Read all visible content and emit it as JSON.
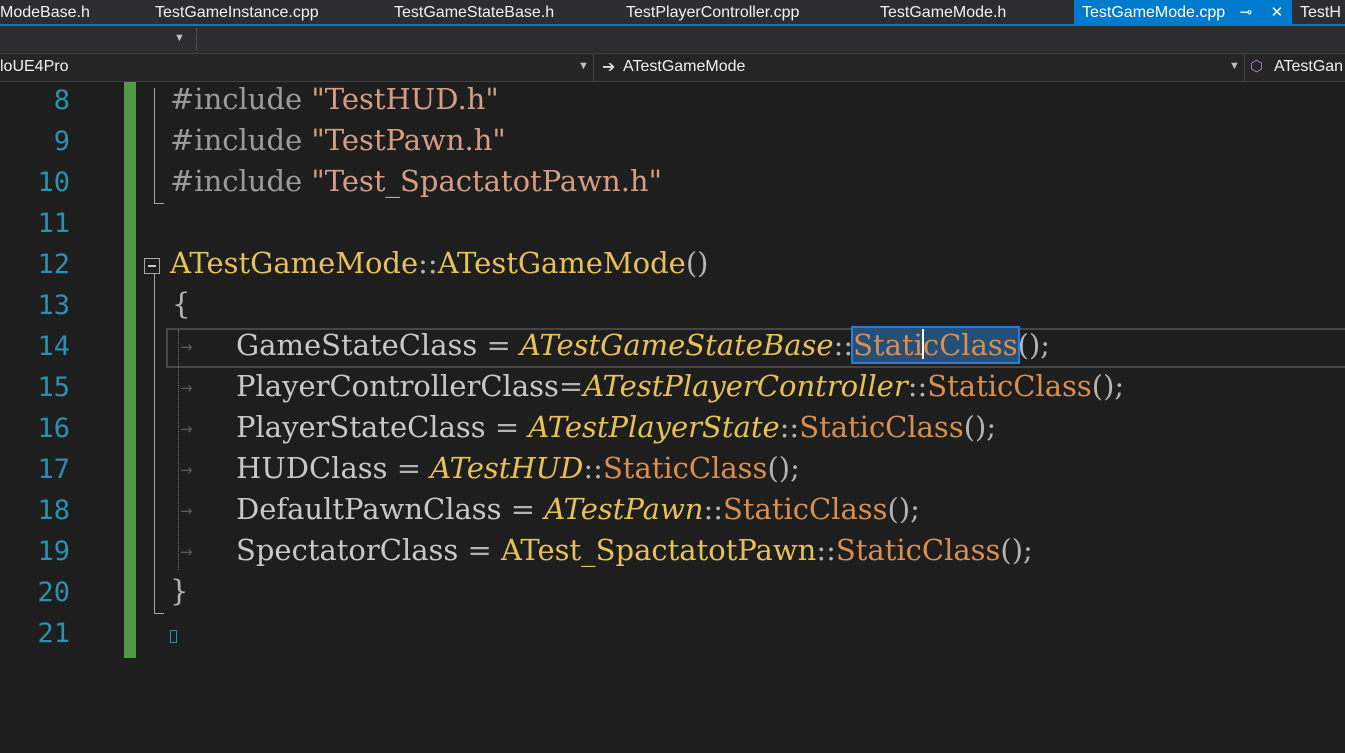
{
  "tabs": [
    {
      "label": "ModeBase.h"
    },
    {
      "label": "TestGameInstance.cpp"
    },
    {
      "label": "TestGameStateBase.h"
    },
    {
      "label": "TestPlayerController.cpp"
    },
    {
      "label": "TestGameMode.h"
    },
    {
      "label": "TestGameMode.cpp",
      "active": true,
      "pin_icon": "pin-icon",
      "close_icon": "close-icon"
    },
    {
      "label": "TestH"
    }
  ],
  "navbar": {
    "project": "loUE4Pro",
    "class_scope": "ATestGameMode",
    "member_scope": "ATestGan"
  },
  "editor": {
    "line_numbers": [
      "8",
      "9",
      "10",
      "11",
      "12",
      "13",
      "14",
      "15",
      "16",
      "17",
      "18",
      "19",
      "20",
      "21"
    ],
    "lines": {
      "l8": {
        "pre": "#include ",
        "str": "\"TestHUD.h\""
      },
      "l9": {
        "pre": "#include ",
        "str": "\"TestPawn.h\""
      },
      "l10": {
        "pre": "#include ",
        "str": "\"Test_SpactatotPawn.h\""
      },
      "l12": {
        "cls": "ATestGameMode",
        "sep": "::",
        "ctor": "ATestGameMode",
        "parens": "()"
      },
      "l13": {
        "brace": "{"
      },
      "l14": {
        "var": "GameStateClass",
        "eq": " = ",
        "cls": "ATestGameStateBase",
        "sep": "::",
        "fn_a": "Stati",
        "fn_b": "cClass",
        "tail": "();"
      },
      "l15": {
        "var": "PlayerControllerClass",
        "eq": "=",
        "cls": "ATestPlayerController",
        "sep": "::",
        "fn": "StaticClass",
        "tail": "();"
      },
      "l16": {
        "var": "PlayerStateClass",
        "eq": " = ",
        "cls": "ATestPlayerState",
        "sep": "::",
        "fn": "StaticClass",
        "tail": "();"
      },
      "l17": {
        "var": "HUDClass",
        "eq": " = ",
        "cls": "ATestHUD",
        "sep": "::",
        "fn": "StaticClass",
        "tail": "();"
      },
      "l18": {
        "var": "DefaultPawnClass",
        "eq": " = ",
        "cls": "ATestPawn",
        "sep": "::",
        "fn": "StaticClass",
        "tail": "();"
      },
      "l19": {
        "var": "SpectatorClass",
        "eq": " = ",
        "cls": "ATest_SpactatotPawn",
        "sep": "::",
        "fn": "StaticClass",
        "tail": "();"
      },
      "l20": {
        "brace": "}"
      }
    },
    "selected_text": "StaticClass",
    "colors": {
      "background": "#1e1e1e",
      "line_number": "#2b91af",
      "change_bar": "#57a64a",
      "selection": "#264f78",
      "active_tab": "#007acc"
    }
  }
}
